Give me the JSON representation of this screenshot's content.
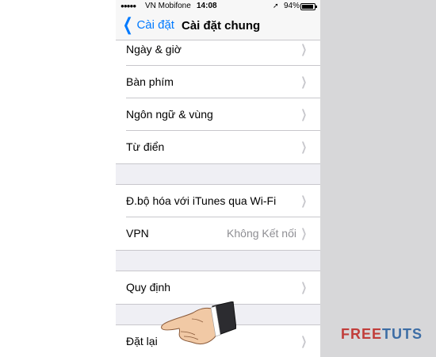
{
  "status_bar": {
    "carrier": "VN Mobifone",
    "time": "14:08",
    "battery": "94%"
  },
  "nav": {
    "back_label": "Cài đặt",
    "title": "Cài đặt chung"
  },
  "groups": [
    {
      "items": [
        {
          "label": "Ngày & giờ"
        },
        {
          "label": "Bàn phím"
        },
        {
          "label": "Ngôn ngữ & vùng"
        },
        {
          "label": "Từ điển"
        }
      ]
    },
    {
      "items": [
        {
          "label": "Đ.bộ hóa với iTunes qua Wi-Fi"
        },
        {
          "label": "VPN",
          "value": "Không Kết nối"
        }
      ]
    },
    {
      "items": [
        {
          "label": "Quy định"
        }
      ]
    },
    {
      "items": [
        {
          "label": "Đặt lại"
        }
      ]
    }
  ],
  "watermark": {
    "left": "FREE",
    "right": "TUTS"
  },
  "colors": {
    "accent": "#007aff",
    "background": "#efeff4",
    "separator": "#c8c7cc",
    "chevron": "#c7c7cc",
    "watermark_red": "#c13d3a",
    "watermark_blue": "#3d6da5"
  },
  "icons": {
    "back": "chevron-left-icon",
    "row": "chevron-right-icon",
    "location": "location-arrow-icon",
    "battery": "battery-icon",
    "signal": "signal-dots-icon",
    "pointer": "pointing-hand-icon"
  }
}
